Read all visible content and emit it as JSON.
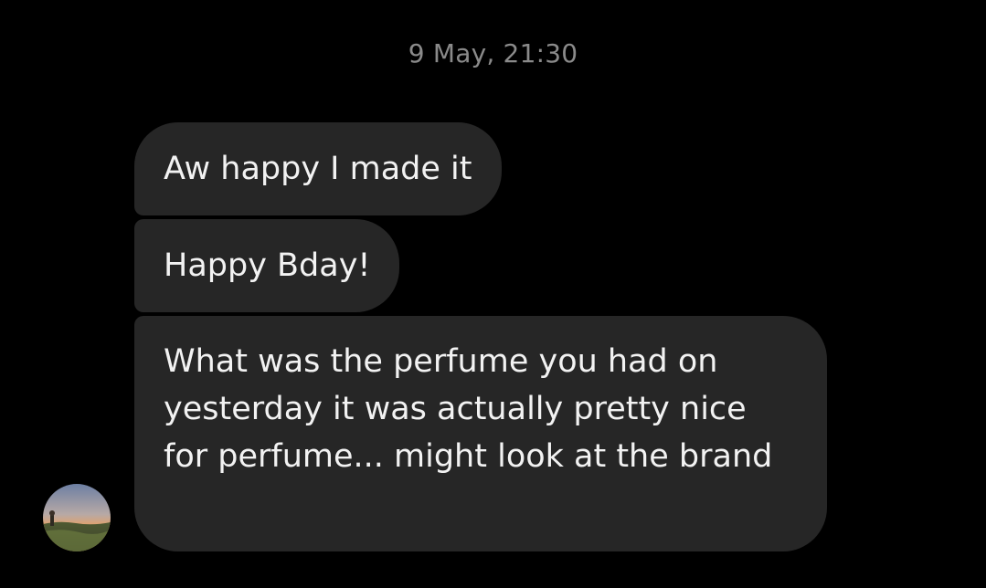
{
  "conversation": {
    "timestamp": "9 May, 21:30",
    "messages": [
      {
        "text": "Aw happy I made it"
      },
      {
        "text": "Happy Bday!"
      },
      {
        "text": "What was the perfume you had on yesterday it was actually pretty nice for perfume... might look at the brand"
      }
    ],
    "sender_avatar": {
      "icon": "profile-photo-landscape-sunset"
    }
  }
}
